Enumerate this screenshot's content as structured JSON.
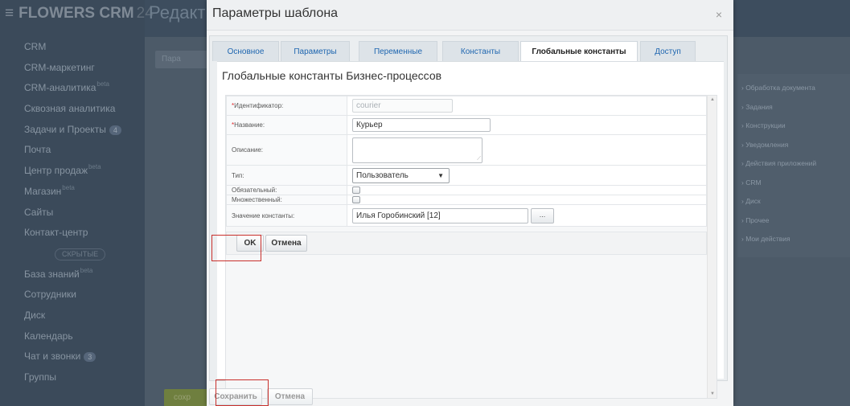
{
  "background": {
    "logo": "FLOWERS CRM",
    "logo_number": "24",
    "page_title": "Редакт",
    "left_button": "Пара",
    "save_button": "сохр",
    "nav": [
      {
        "label": "CRM"
      },
      {
        "label": "CRM-маркетинг"
      },
      {
        "label": "CRM-аналитика",
        "sup": "beta"
      },
      {
        "label": "Сквозная аналитика"
      },
      {
        "label": "Задачи и Проекты",
        "count": "4"
      },
      {
        "label": "Почта"
      },
      {
        "label": "Центр продаж",
        "sup": "beta"
      },
      {
        "label": "Магазин",
        "sup": "beta"
      },
      {
        "label": "Сайты"
      },
      {
        "label": "Контакт-центр"
      },
      {
        "label": "",
        "pill": "СКРЫТЫЕ"
      },
      {
        "label": "База знаний",
        "sup": "beta"
      },
      {
        "label": "Сотрудники"
      },
      {
        "label": "Диск"
      },
      {
        "label": "Календарь"
      },
      {
        "label": "Чат и звонки",
        "count": "3"
      },
      {
        "label": "Группы"
      }
    ],
    "right_panel": [
      "› Обработка документа",
      "› Задания",
      "› Конструкции",
      "› Уведомления",
      "› Действия приложений",
      "› CRM",
      "› Диск",
      "› Прочее",
      "› Мои действия"
    ]
  },
  "dialog": {
    "title": "Параметры шаблона",
    "close": "×",
    "tabs": [
      {
        "label": "Основное"
      },
      {
        "label": "Параметры"
      },
      {
        "label": "Переменные"
      },
      {
        "label": "Константы"
      },
      {
        "label": "Глобальные константы"
      },
      {
        "label": "Доступ"
      }
    ],
    "section_title": "Глобальные константы Бизнес-процессов",
    "form": {
      "id_label": "Идентификатор:",
      "id_value": "courier",
      "name_label": "Название:",
      "name_value": "Курьер",
      "desc_label": "Описание:",
      "type_label": "Тип:",
      "type_value": "Пользователь",
      "required_label": "Обязательный:",
      "multiple_label": "Множественный:",
      "value_label": "Значение константы:",
      "value_value": "Илья Горобинский [12]",
      "dots": "...",
      "ok": "OK",
      "cancel": "Отмена"
    },
    "footer": {
      "save": "Сохранить",
      "cancel": "Отмена"
    }
  }
}
